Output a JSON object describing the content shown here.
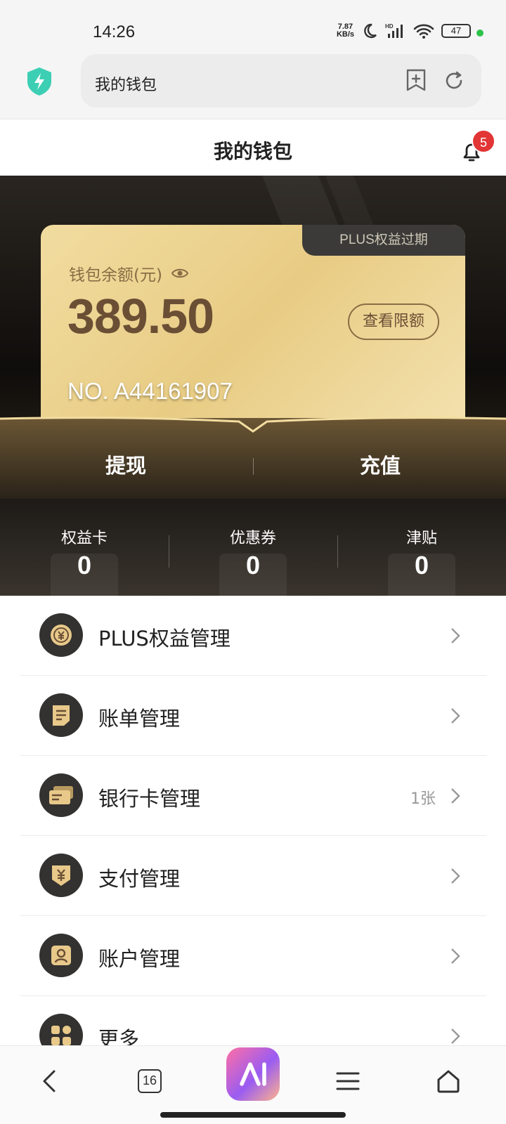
{
  "status_bar": {
    "time": "14:26",
    "speed_top": "7.87",
    "speed_bottom": "KB/s",
    "battery": "47"
  },
  "address_bar": {
    "url_text": "我的钱包"
  },
  "header": {
    "title": "我的钱包",
    "notification_count": "5"
  },
  "wallet_card": {
    "plus_status": "PLUS权益过期",
    "balance_label": "钱包余额(元)",
    "balance": "389.50",
    "limit_button": "查看限额",
    "card_number": "NO. A44161907"
  },
  "actions": {
    "withdraw": "提现",
    "recharge": "充值"
  },
  "stats": [
    {
      "label": "权益卡",
      "value": "0"
    },
    {
      "label": "优惠券",
      "value": "0"
    },
    {
      "label": "津贴",
      "value": "0"
    }
  ],
  "menu": [
    {
      "label": "PLUS权益管理",
      "icon": "coin-icon",
      "extra": ""
    },
    {
      "label": "账单管理",
      "icon": "bill-icon",
      "extra": ""
    },
    {
      "label": "银行卡管理",
      "icon": "bank-card-icon",
      "extra": "1张"
    },
    {
      "label": "支付管理",
      "icon": "yuan-shield-icon",
      "extra": ""
    },
    {
      "label": "账户管理",
      "icon": "user-card-icon",
      "extra": ""
    },
    {
      "label": "更多",
      "icon": "grid-icon",
      "extra": ""
    }
  ],
  "bottom_nav": {
    "tab_count": "16"
  },
  "colors": {
    "gold": "#e8cc84",
    "dark": "#333230",
    "badge": "#e23535",
    "accent_text": "#6a4f35"
  }
}
